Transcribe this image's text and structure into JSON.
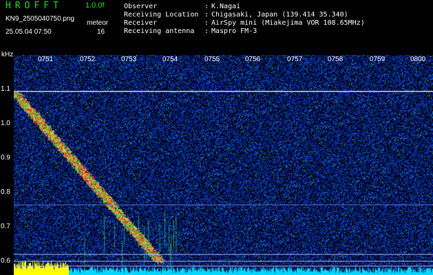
{
  "header": {
    "app_title": "HROFFT",
    "version": "1.0.0f",
    "filename": "KN9_2505040750.png",
    "datetime": "25.05.04 07:50",
    "label": "meteor",
    "count": "16",
    "info": [
      {
        "key": "Observer",
        "value": "K.Nagai"
      },
      {
        "key": "Receiving Location",
        "value": "Chigasaki, Japan (139.414 35.340)"
      },
      {
        "key": "Receiver",
        "value": "AirSpy mini (Miakejima VOR 108.65MHz)"
      },
      {
        "key": "Receiving antenna",
        "value": "Maspro FM-3"
      }
    ]
  },
  "plot": {
    "unit": "kHz",
    "y_ticks": [
      "1.1",
      "1.0",
      "0.9",
      "0.8",
      "0.7",
      "0.6"
    ],
    "time_ticks": [
      "0751",
      "0752",
      "0753",
      "0754",
      "0755",
      "0756",
      "0757",
      "0758",
      "0759",
      "0800"
    ]
  },
  "colors": {
    "background": "#000000",
    "title_green": "#22e022",
    "noise_blue": "#1030a8",
    "carrier": "#e0e0ff",
    "level_yellow": "#ffff00",
    "level_cyan": "#00e0ff"
  }
}
